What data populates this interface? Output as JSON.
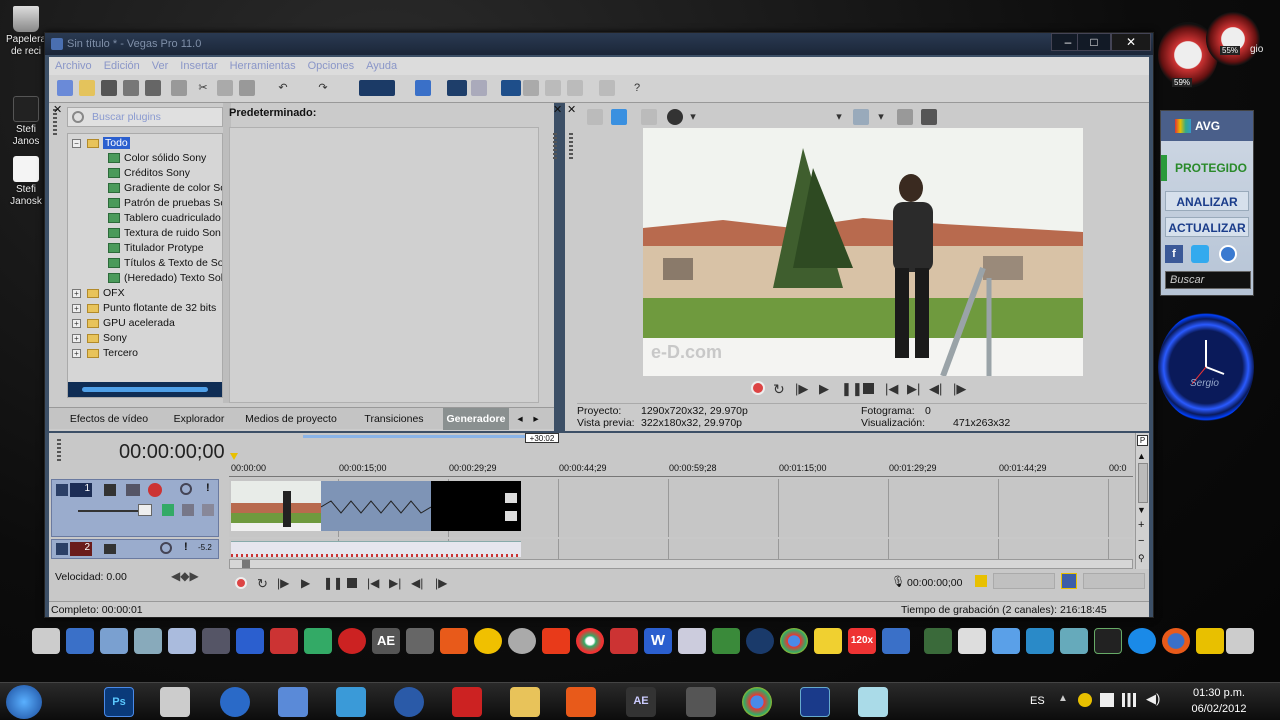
{
  "desktop": {
    "icons": [
      {
        "label": "Papelera de reci",
        "name": "recycle-bin-icon"
      },
      {
        "label": "Stefi Janos",
        "name": "user-folder-icon"
      },
      {
        "label": "Stefi Janosk",
        "name": "user-file-icon"
      }
    ]
  },
  "window": {
    "title": "Sin título * - Vegas Pro 11.0",
    "controls": {
      "minimize": "–",
      "maximize": "□",
      "close": "✕"
    }
  },
  "menu": [
    "Archivo",
    "Edición",
    "Ver",
    "Insertar",
    "Herramientas",
    "Opciones",
    "Ayuda"
  ],
  "plugins": {
    "search_placeholder": "Buscar plugins",
    "preset_header": "Predeterminado:",
    "tree": [
      {
        "label": "Todo",
        "type": "folder",
        "level": 0,
        "expanded": true,
        "selected": true
      },
      {
        "label": "Color sólido Sony",
        "type": "plugin",
        "level": 1
      },
      {
        "label": "Créditos Sony",
        "type": "plugin",
        "level": 1
      },
      {
        "label": "Gradiente de color So",
        "type": "plugin",
        "level": 1
      },
      {
        "label": "Patrón de pruebas Sc",
        "type": "plugin",
        "level": 1
      },
      {
        "label": "Tablero cuadriculado",
        "type": "plugin",
        "level": 1
      },
      {
        "label": "Textura de ruido Son",
        "type": "plugin",
        "level": 1
      },
      {
        "label": "Titulador Protype",
        "type": "plugin",
        "level": 1
      },
      {
        "label": "Títulos & Texto de So",
        "type": "plugin",
        "level": 1
      },
      {
        "label": "(Heredado) Texto Sol",
        "type": "plugin",
        "level": 1
      },
      {
        "label": "OFX",
        "type": "folder",
        "level": 0
      },
      {
        "label": "Punto flotante de 32 bits",
        "type": "folder",
        "level": 0
      },
      {
        "label": "GPU acelerada",
        "type": "folder",
        "level": 0
      },
      {
        "label": "Sony",
        "type": "folder",
        "level": 0
      },
      {
        "label": "Tercero",
        "type": "folder",
        "level": 0
      }
    ],
    "tabs": [
      "Efectos de vídeo",
      "Explorador",
      "Medios de proyecto",
      "Transiciones",
      "Generadore"
    ]
  },
  "preview": {
    "proyecto_label": "Proyecto:",
    "proyecto_value": "1290x720x32, 29.970p",
    "vista_label": "Vista previa:",
    "vista_value": "322x180x32, 29.970p",
    "fotograma_label": "Fotograma:",
    "fotograma_value": "0",
    "visualizacion_label": "Visualización:",
    "visualizacion_value": "471x263x32",
    "watermark": "e-D.com"
  },
  "timeline": {
    "timecode": "00:00:00;00",
    "offset": "+30:02",
    "ruler": [
      "00:00:00",
      "00:00:15;00",
      "00:00:29;29",
      "00:00:44;29",
      "00:00:59;28",
      "00:01:15;00",
      "00:01:29;29",
      "00:01:44;29",
      "00:0"
    ],
    "track1_num": "1",
    "track2_num": "2",
    "track2_level": "-5.2",
    "velocidad": "Velocidad: 0.00",
    "transport_time": "00:00:00;00"
  },
  "status": {
    "left": "Completo: 00:00:01",
    "right": "Tiempo de grabación (2 canales): 216:18:45"
  },
  "gadgets": {
    "avg_title": "AVG",
    "protegido": "PROTEGIDO",
    "analizar": "ANALIZAR",
    "actualizar": "ACTUALIZAR",
    "buscar_placeholder": "Buscar",
    "cpu1": "59%",
    "cpu2": "55%",
    "clock_label": "Sergio",
    "partial_label": "gio"
  },
  "taskbar": {
    "lang": "ES",
    "time": "01:30 p.m.",
    "date": "06/02/2012"
  },
  "colors": {
    "accent": "#3c4f66",
    "desktop": "#0d0d0d",
    "titlebar": "#1b2638"
  }
}
